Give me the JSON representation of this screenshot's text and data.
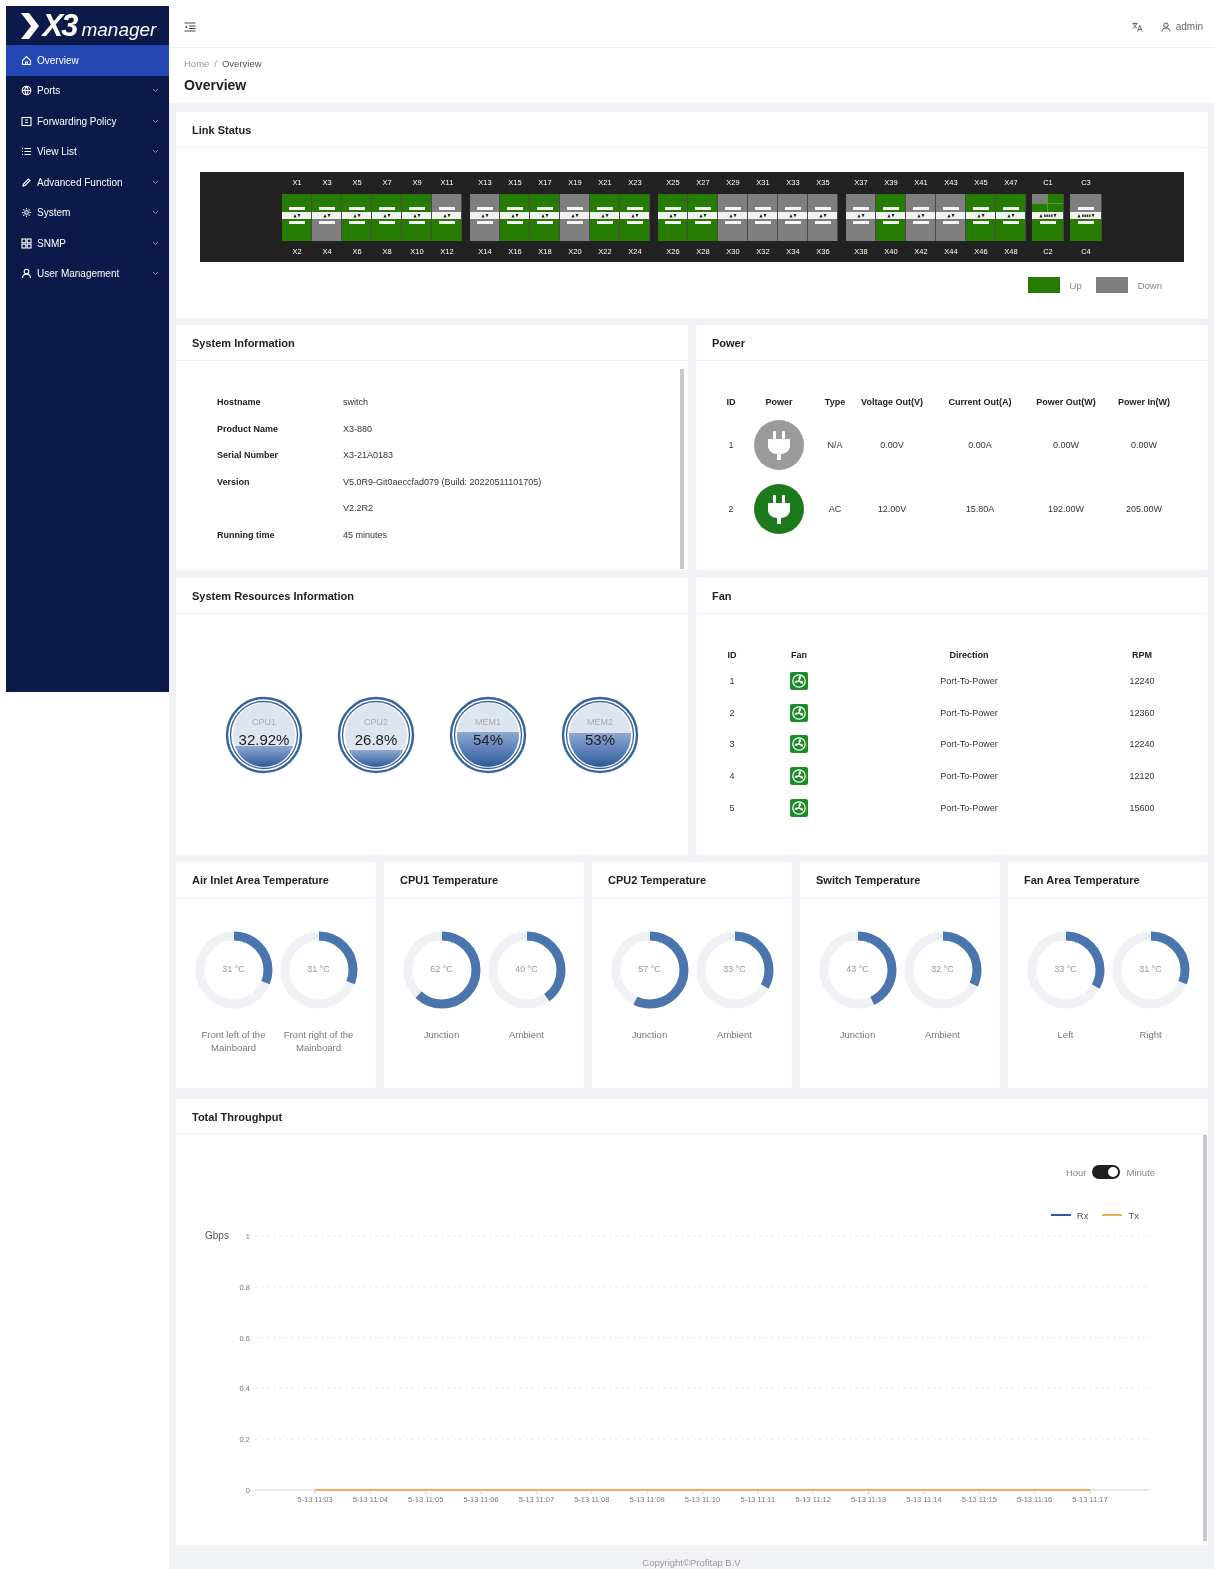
{
  "logo": {
    "mark": "X3",
    "word": "manager"
  },
  "sidebar": {
    "items": [
      {
        "label": "Overview",
        "selected": true,
        "expandable": false
      },
      {
        "label": "Ports",
        "selected": false,
        "expandable": true
      },
      {
        "label": "Forwarding Policy",
        "selected": false,
        "expandable": true
      },
      {
        "label": "View List",
        "selected": false,
        "expandable": true
      },
      {
        "label": "Advanced Function",
        "selected": false,
        "expandable": true
      },
      {
        "label": "System",
        "selected": false,
        "expandable": true
      },
      {
        "label": "SNMP",
        "selected": false,
        "expandable": true
      },
      {
        "label": "User Management",
        "selected": false,
        "expandable": true
      }
    ]
  },
  "header": {
    "user": "admin"
  },
  "breadcrumb": {
    "items": [
      "Home",
      "Overview"
    ],
    "separator": "/"
  },
  "page_title": "Overview",
  "link_status": {
    "title": "Link Status",
    "groups": [
      {
        "columns": [
          {
            "top": {
              "label": "X1",
              "up": true
            },
            "bottom": {
              "label": "X2",
              "up": true
            }
          },
          {
            "top": {
              "label": "X3",
              "up": true
            },
            "bottom": {
              "label": "X4",
              "up": false
            }
          },
          {
            "top": {
              "label": "X5",
              "up": true
            },
            "bottom": {
              "label": "X6",
              "up": true
            }
          },
          {
            "top": {
              "label": "X7",
              "up": true
            },
            "bottom": {
              "label": "X8",
              "up": true
            }
          },
          {
            "top": {
              "label": "X9",
              "up": true
            },
            "bottom": {
              "label": "X10",
              "up": true
            }
          },
          {
            "top": {
              "label": "X11",
              "up": false
            },
            "bottom": {
              "label": "X12",
              "up": true
            }
          }
        ]
      },
      {
        "columns": [
          {
            "top": {
              "label": "X13",
              "up": false
            },
            "bottom": {
              "label": "X14",
              "up": false
            }
          },
          {
            "top": {
              "label": "X15",
              "up": true
            },
            "bottom": {
              "label": "X16",
              "up": true
            }
          },
          {
            "top": {
              "label": "X17",
              "up": true
            },
            "bottom": {
              "label": "X18",
              "up": true
            }
          },
          {
            "top": {
              "label": "X19",
              "up": false
            },
            "bottom": {
              "label": "X20",
              "up": false
            }
          },
          {
            "top": {
              "label": "X21",
              "up": true
            },
            "bottom": {
              "label": "X22",
              "up": true
            }
          },
          {
            "top": {
              "label": "X23",
              "up": true
            },
            "bottom": {
              "label": "X24",
              "up": true
            }
          }
        ]
      },
      {
        "columns": [
          {
            "top": {
              "label": "X25",
              "up": true
            },
            "bottom": {
              "label": "X26",
              "up": true
            }
          },
          {
            "top": {
              "label": "X27",
              "up": true
            },
            "bottom": {
              "label": "X28",
              "up": true
            }
          },
          {
            "top": {
              "label": "X29",
              "up": false
            },
            "bottom": {
              "label": "X30",
              "up": false
            }
          },
          {
            "top": {
              "label": "X31",
              "up": false
            },
            "bottom": {
              "label": "X32",
              "up": false
            }
          },
          {
            "top": {
              "label": "X33",
              "up": false
            },
            "bottom": {
              "label": "X34",
              "up": false
            }
          },
          {
            "top": {
              "label": "X35",
              "up": false
            },
            "bottom": {
              "label": "X36",
              "up": false
            }
          }
        ]
      },
      {
        "columns": [
          {
            "top": {
              "label": "X37",
              "up": false
            },
            "bottom": {
              "label": "X38",
              "up": false
            }
          },
          {
            "top": {
              "label": "X39",
              "up": true
            },
            "bottom": {
              "label": "X40",
              "up": true
            }
          },
          {
            "top": {
              "label": "X41",
              "up": false
            },
            "bottom": {
              "label": "X42",
              "up": false
            }
          },
          {
            "top": {
              "label": "X43",
              "up": false
            },
            "bottom": {
              "label": "X44",
              "up": false
            }
          },
          {
            "top": {
              "label": "X45",
              "up": true
            },
            "bottom": {
              "label": "X46",
              "up": true
            }
          },
          {
            "top": {
              "label": "X47",
              "up": true
            },
            "bottom": {
              "label": "X48",
              "up": true
            }
          }
        ]
      }
    ],
    "breakouts": [
      {
        "top": {
          "label": "C1",
          "lanes": [
            {
              "up": false
            },
            {
              "up": true
            },
            {
              "up": true
            },
            {
              "up": true
            }
          ]
        },
        "bottom": {
          "label": "C2",
          "up": true
        }
      },
      {
        "top": {
          "label": "C3",
          "up": false
        },
        "bottom": {
          "label": "C4",
          "up": true
        }
      }
    ],
    "legend": [
      {
        "label": "Up",
        "up": true
      },
      {
        "label": "Down",
        "up": false
      }
    ]
  },
  "system_information": {
    "title": "System Information",
    "rows": [
      {
        "label": "Hostname",
        "values": [
          "switch"
        ]
      },
      {
        "label": "Product Name",
        "values": [
          "X3-880"
        ]
      },
      {
        "label": "Serial Number",
        "values": [
          "X3-21A0183"
        ]
      },
      {
        "label": "Version",
        "values": [
          "V5.0R9-Git0aeccfad079 (Build: 20220511101705)",
          "V2.2R2"
        ]
      },
      {
        "label": "Running time",
        "values": [
          "45 minutes"
        ]
      }
    ]
  },
  "power": {
    "title": "Power",
    "columns": [
      "ID",
      "Power",
      "Type",
      "Voltage Out(V)",
      "Current Out(A)",
      "Power Out(W)",
      "Power In(W)"
    ],
    "rows": [
      {
        "id": "1",
        "on": false,
        "type": "N/A",
        "voltage": "0.00V",
        "current": "0.00A",
        "power_out": "0.00W",
        "power_in": "0.00W"
      },
      {
        "id": "2",
        "on": true,
        "type": "AC",
        "voltage": "12.00V",
        "current": "15.80A",
        "power_out": "192.00W",
        "power_in": "205.00W"
      }
    ]
  },
  "resources": {
    "title": "System Resources Information",
    "gauges": [
      {
        "label": "CPU1",
        "value": "32.92%",
        "level": 0.3292
      },
      {
        "label": "CPU2",
        "value": "26.8%",
        "level": 0.268
      },
      {
        "label": "MEM1",
        "value": "54%",
        "level": 0.54
      },
      {
        "label": "MEM2",
        "value": "53%",
        "level": 0.53
      }
    ]
  },
  "fan": {
    "title": "Fan",
    "columns": [
      "ID",
      "Fan",
      "Direction",
      "RPM"
    ],
    "rows": [
      {
        "id": "1",
        "direction": "Port-To-Power",
        "rpm": "12240"
      },
      {
        "id": "2",
        "direction": "Port-To-Power",
        "rpm": "12360"
      },
      {
        "id": "3",
        "direction": "Port-To-Power",
        "rpm": "12240"
      },
      {
        "id": "4",
        "direction": "Port-To-Power",
        "rpm": "12120"
      },
      {
        "id": "5",
        "direction": "Port-To-Power",
        "rpm": "15600"
      }
    ]
  },
  "temperatures": [
    {
      "title": "Air Inlet Area Temperature",
      "sensors": [
        {
          "value": "31 °C",
          "level": 0.31,
          "label": "Front left of the Mainboard"
        },
        {
          "value": "31 °C",
          "level": 0.31,
          "label": "Front right of the Mainboard"
        }
      ]
    },
    {
      "title": "CPU1 Temperature",
      "sensors": [
        {
          "value": "62 °C",
          "level": 0.62,
          "label": "Junction"
        },
        {
          "value": "40 °C",
          "level": 0.4,
          "label": "Ambient"
        }
      ]
    },
    {
      "title": "CPU2 Temperature",
      "sensors": [
        {
          "value": "57 °C",
          "level": 0.57,
          "label": "Junction"
        },
        {
          "value": "33 °C",
          "level": 0.33,
          "label": "Ambient"
        }
      ]
    },
    {
      "title": "Switch Temperature",
      "sensors": [
        {
          "value": "43 °C",
          "level": 0.43,
          "label": "Junction"
        },
        {
          "value": "32 °C",
          "level": 0.32,
          "label": "Ambient"
        }
      ]
    },
    {
      "title": "Fan Area Temperature",
      "sensors": [
        {
          "value": "33 °C",
          "level": 0.33,
          "label": "Left"
        },
        {
          "value": "31 °C",
          "level": 0.31,
          "label": "Right"
        }
      ]
    }
  ],
  "throughput": {
    "title": "Total Throughput",
    "toggle": {
      "left": "Hour",
      "right": "Minute",
      "on": true
    },
    "chart_data": {
      "type": "line",
      "ylabel": "Gbps",
      "categories": [
        "5-13 11:03",
        "5-13 11:04",
        "5-13 11:05",
        "5-13 11:06",
        "5-13 11:07",
        "5-13 11:08",
        "5-13 11:09",
        "5-13 11:10",
        "5-13 11:11",
        "5-13 11:12",
        "5-13 11:13",
        "5-13 11:14",
        "5-13 11:15",
        "5-13 11:16",
        "5-13 11:17"
      ],
      "series": [
        {
          "name": "Rx",
          "color": "#2f55a4",
          "values": [
            null,
            null,
            null,
            null,
            null,
            null,
            null,
            null,
            null,
            null,
            null,
            null,
            null,
            null,
            null
          ]
        },
        {
          "name": "Tx",
          "color": "#f0ad5a",
          "values": [
            0,
            0,
            0,
            0,
            0,
            0,
            0,
            0,
            0,
            0,
            0,
            0,
            0,
            0,
            0
          ]
        }
      ],
      "ylim": [
        0,
        1
      ],
      "yticks": [
        0,
        0.2,
        0.4,
        0.6,
        0.8,
        1
      ],
      "grid": true
    }
  },
  "footer": "Copyright©Profitap B.V"
}
